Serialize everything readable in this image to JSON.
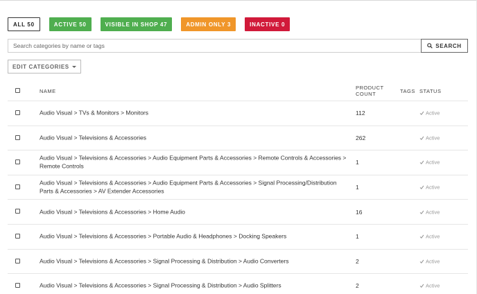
{
  "filters": {
    "all": "ALL 50",
    "active": "ACTIVE 50",
    "visible": "VISIBLE IN SHOP 47",
    "admin": "ADMIN ONLY 3",
    "inactive": "INACTIVE 0"
  },
  "search": {
    "placeholder": "Search categories by name or tags",
    "value": "",
    "button_label": "SEARCH",
    "icon": "search-icon"
  },
  "edit_button": {
    "label": "EDIT CATEGORIES",
    "icon": "caret-down-icon"
  },
  "table": {
    "headers": {
      "name": "NAME",
      "count": "PRODUCT COUNT",
      "tags": "TAGS",
      "status": "STATUS"
    },
    "rows": [
      {
        "name": "Audio Visual > TVs & Monitors > Monitors",
        "count": "112",
        "tags": "",
        "status": "Active"
      },
      {
        "name": "Audio Visual > Televisions & Accessories",
        "count": "262",
        "tags": "",
        "status": "Active"
      },
      {
        "name": "Audio Visual > Televisions & Accessories > Audio Equipment Parts & Accessories > Remote Controls & Accessories > Remote Controls",
        "count": "1",
        "tags": "",
        "status": "Active"
      },
      {
        "name": "Audio Visual > Televisions & Accessories > Audio Equipment Parts & Accessories > Signal Processing/Distribution Parts & Accessories > AV Extender Accessories",
        "count": "1",
        "tags": "",
        "status": "Active"
      },
      {
        "name": "Audio Visual > Televisions & Accessories > Home Audio",
        "count": "16",
        "tags": "",
        "status": "Active"
      },
      {
        "name": "Audio Visual > Televisions & Accessories > Portable Audio & Headphones > Docking Speakers",
        "count": "1",
        "tags": "",
        "status": "Active"
      },
      {
        "name": "Audio Visual > Televisions & Accessories > Signal Processing & Distribution > Audio Converters",
        "count": "2",
        "tags": "",
        "status": "Active"
      },
      {
        "name": "Audio Visual > Televisions & Accessories > Signal Processing & Distribution > Audio Splitters",
        "count": "2",
        "tags": "",
        "status": "Active"
      }
    ]
  },
  "colors": {
    "green": "#4fae4f",
    "orange": "#f0962a",
    "red": "#d11a3a",
    "status_text": "#999999"
  }
}
